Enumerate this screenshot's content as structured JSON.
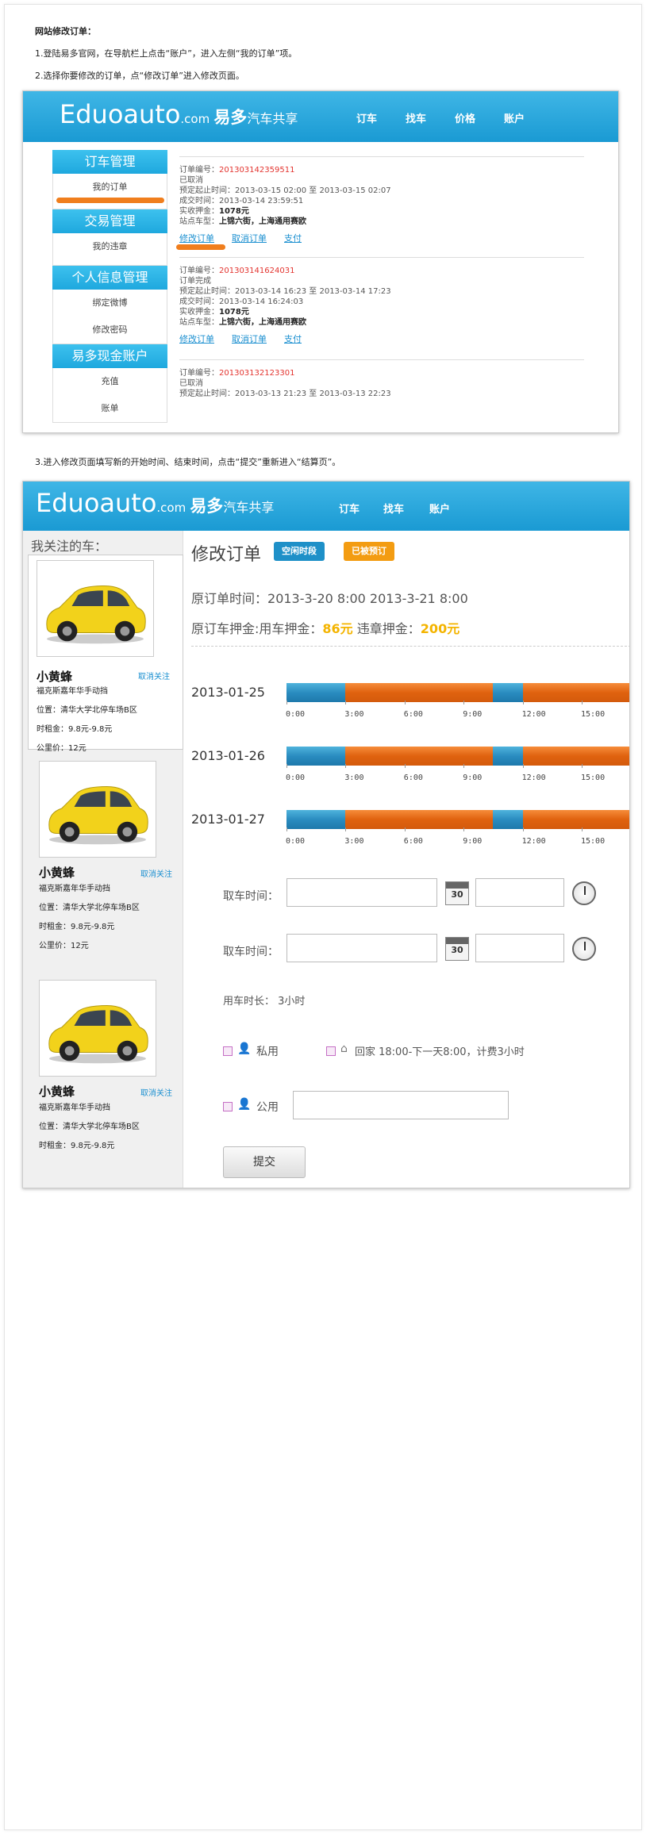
{
  "instructions": {
    "title": "网站修改订单：",
    "step1": "1.登陆易多官网，在导航栏上点击“账户”，进入左侧“我的订单”项。",
    "step2": "2.选择你要修改的订单，点“修改订单”进入修改页面。",
    "step3": "3.进入修改页面填写新的开始时间、结束时间，点击“提交”重新进入“结算页”。"
  },
  "header": {
    "logo_main": "Eduoauto",
    "logo_com": ".com",
    "logo_cn_brand": "易多",
    "logo_cn_sub": "汽车共享",
    "nav1": [
      "订车",
      "找车",
      "价格",
      "账户"
    ],
    "nav2": [
      "订车",
      "找车",
      "账户"
    ]
  },
  "shot1": {
    "sidebar": [
      {
        "title": "订车管理",
        "items": [
          "我的订单"
        ]
      },
      {
        "title": "交易管理",
        "items": [
          "我的违章"
        ]
      },
      {
        "title": "个人信息管理",
        "items": [
          "绑定微博",
          "修改密码"
        ]
      },
      {
        "title": "易多现金账户",
        "items": [
          "充值",
          "账单"
        ]
      }
    ],
    "orders": [
      {
        "id_label": "订单编号：",
        "id": "201303142359511",
        "status": "已取消",
        "planned_label": "预定起止时间：",
        "planned": "2013-03-15 02:00 至 2013-03-15 02:07",
        "deal_label": "成交时间：",
        "deal": "2013-03-14 23:59:51",
        "deposit_label": "实收押金：",
        "deposit": "1078元",
        "station_label": "站点车型：",
        "station": "上锦六街，上海通用赛欧",
        "links": [
          "修改订单",
          "取消订单",
          "支付"
        ]
      },
      {
        "id_label": "订单编号：",
        "id": "201303141624031",
        "status": "订单完成",
        "planned_label": "预定起止时间：",
        "planned": "2013-03-14 16:23 至 2013-03-14 17:23",
        "deal_label": "成交时间：",
        "deal": "2013-03-14 16:24:03",
        "deposit_label": "实收押金：",
        "deposit": "1078元",
        "station_label": "站点车型：",
        "station": "上锦六街，上海通用赛欧",
        "links": [
          "修改订单",
          "取消订单",
          "支付"
        ]
      },
      {
        "id_label": "订单编号：",
        "id": "201303132123301",
        "status": "已取消",
        "planned_label": "预定起止时间：",
        "planned": "2013-03-13 21:23 至 2013-03-13 22:23"
      }
    ]
  },
  "shot2": {
    "watch_title": "我关注的车：",
    "cars": [
      {
        "name": "小黄蜂",
        "unfollow": "取消关注",
        "model": "福克斯嘉年华手动挡",
        "location": "位置：清华大学北停车场B区",
        "hourly": "时租金：9.8元-9.8元",
        "km_price": "公里价：12元"
      },
      {
        "name": "小黄蜂",
        "unfollow": "取消关注",
        "model": "福克斯嘉年华手动挡",
        "location": "位置：清华大学北停车场B区",
        "hourly": "时租金：9.8元-9.8元",
        "km_price": "公里价：12元"
      },
      {
        "name": "小黄蜂",
        "unfollow": "取消关注",
        "model": "福克斯嘉年华手动挡",
        "location": "位置：清华大学北停车场B区",
        "hourly": "时租金：9.8元-9.8元"
      }
    ],
    "page_title": "修改订单",
    "badge_free": "空闲时段",
    "badge_booked": "已被预订",
    "colors": {
      "free": "#1e90c8",
      "booked": "#e8680f",
      "accent_yellow": "#f4b400"
    },
    "orig_time_label": "原订单时间：",
    "orig_time": "2013-3-20 8:00 2013-3-21 8:00",
    "orig_deposit_label": "原订车押金:用车押金：",
    "orig_deposit": "86元",
    "violation_label": "违章押金：",
    "violation_deposit": "200元",
    "tick_labels": [
      "0:00",
      "3:00",
      "6:00",
      "9:00",
      "12:00",
      "15:00"
    ],
    "days": [
      {
        "date": "2013-01-25",
        "segments": [
          {
            "from": 0,
            "to": 3,
            "state": "free"
          },
          {
            "from": 3,
            "to": 10.5,
            "state": "booked"
          },
          {
            "from": 10.5,
            "to": 12,
            "state": "free"
          },
          {
            "from": 12,
            "to": 17.5,
            "state": "booked"
          }
        ]
      },
      {
        "date": "2013-01-26",
        "segments": [
          {
            "from": 0,
            "to": 3,
            "state": "free"
          },
          {
            "from": 3,
            "to": 10.5,
            "state": "booked"
          },
          {
            "from": 10.5,
            "to": 12,
            "state": "free"
          },
          {
            "from": 12,
            "to": 17.5,
            "state": "booked"
          }
        ]
      },
      {
        "date": "2013-01-27",
        "segments": [
          {
            "from": 0,
            "to": 3,
            "state": "free"
          },
          {
            "from": 3,
            "to": 10.5,
            "state": "booked"
          },
          {
            "from": 10.5,
            "to": 12,
            "state": "free"
          },
          {
            "from": 12,
            "to": 17.5,
            "state": "booked"
          }
        ]
      }
    ],
    "pickup_label": "取车时间：",
    "return_label": "取车时间：",
    "calendar_day": "30",
    "duration_label": "用车时长：",
    "duration": "3小时",
    "opt_private": "私用",
    "opt_home": "回家 18:00-下一天8:00，计费3小时",
    "opt_public": "公用",
    "submit": "提交"
  }
}
